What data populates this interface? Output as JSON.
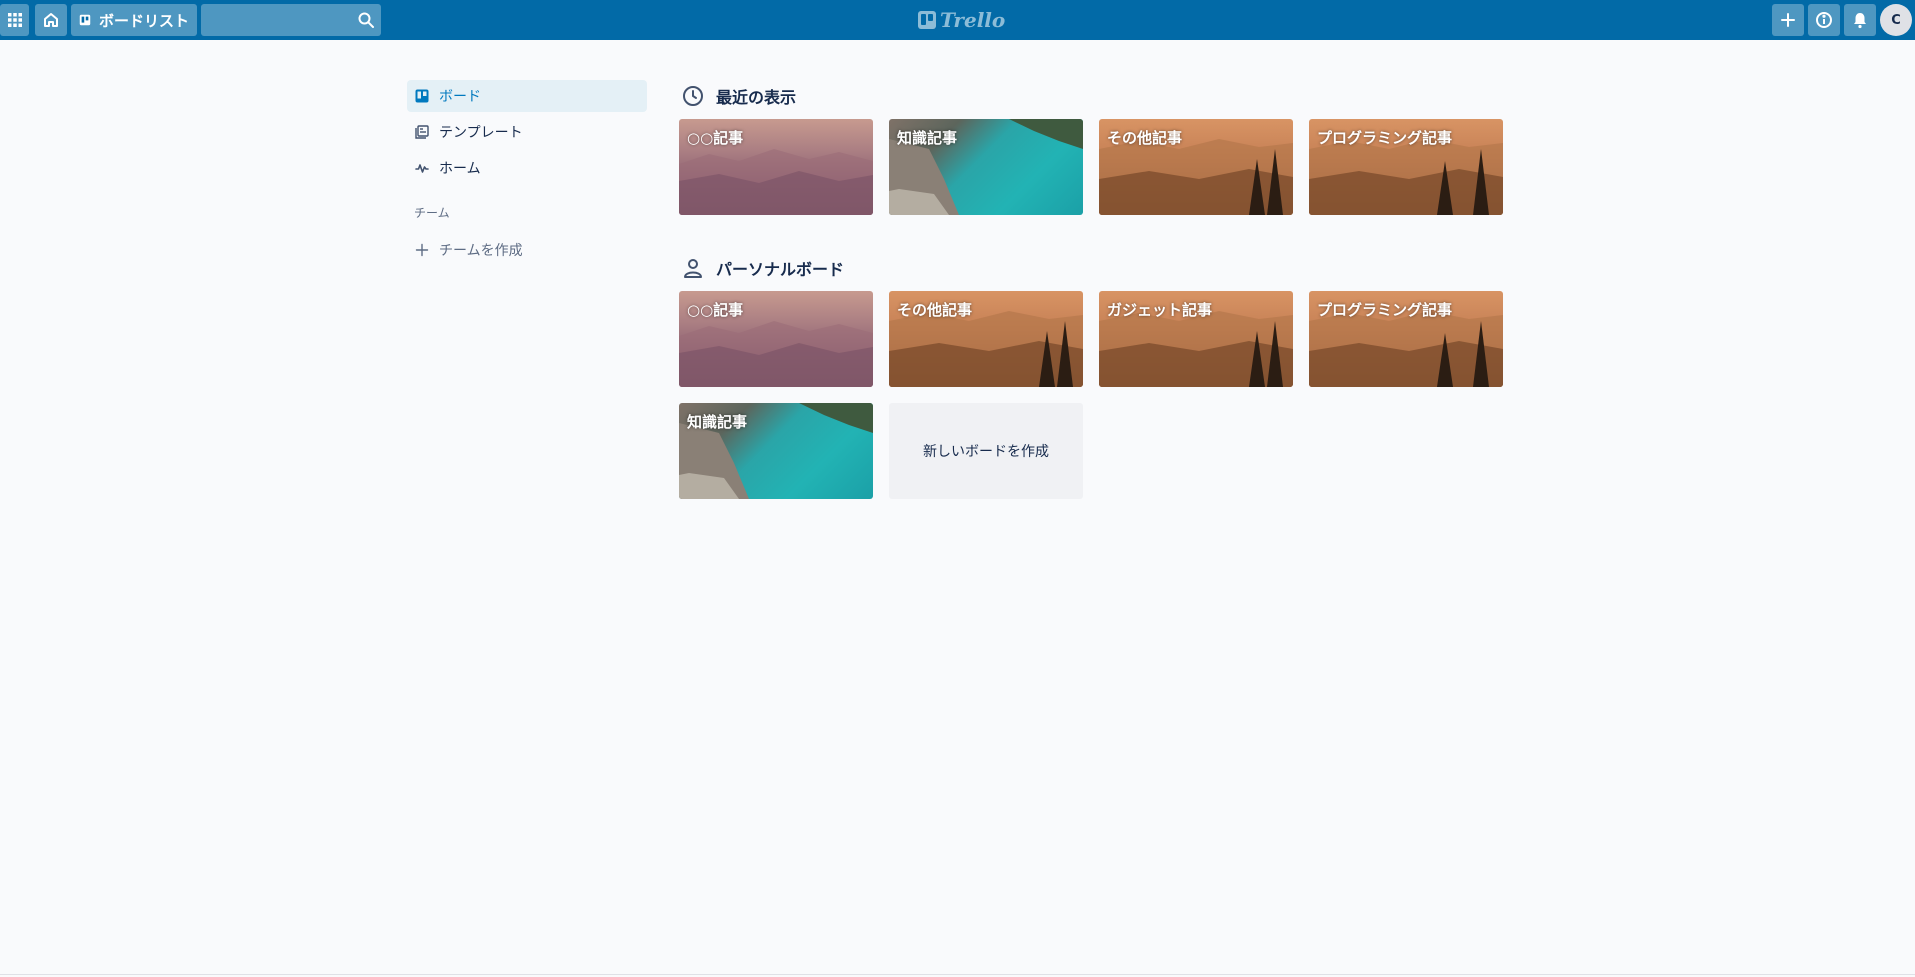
{
  "header": {
    "board_list_label": "ボードリスト",
    "search_placeholder": "",
    "logo_text": "Trello",
    "avatar_initial": "C",
    "bg_color": "#026aa7"
  },
  "sidebar": {
    "items": [
      {
        "label": "ボード",
        "icon": "board-icon",
        "active": true
      },
      {
        "label": "テンプレート",
        "icon": "template-icon",
        "active": false
      },
      {
        "label": "ホーム",
        "icon": "activity-icon",
        "active": false
      }
    ],
    "team_heading": "チーム",
    "create_team_label": "チームを作成"
  },
  "recent": {
    "title": "最近の表示",
    "icon": "clock-icon",
    "boards": [
      {
        "name": "○○記事",
        "background": "mountain"
      },
      {
        "name": "知識記事",
        "background": "lake"
      },
      {
        "name": "その他記事",
        "background": "sunset"
      },
      {
        "name": "プログラミング記事",
        "background": "sunset"
      }
    ]
  },
  "personal": {
    "title": "パーソナルボード",
    "icon": "person-icon",
    "boards": [
      {
        "name": "○○記事",
        "background": "mountain"
      },
      {
        "name": "その他記事",
        "background": "sunset"
      },
      {
        "name": "ガジェット記事",
        "background": "sunset"
      },
      {
        "name": "プログラミング記事",
        "background": "sunset"
      },
      {
        "name": "知識記事",
        "background": "lake"
      }
    ],
    "create_board_label": "新しいボードを作成"
  },
  "colors": {
    "accent": "#0079bf",
    "page_bg": "#f9fafc",
    "active_item_bg": "#e4f0f6"
  }
}
